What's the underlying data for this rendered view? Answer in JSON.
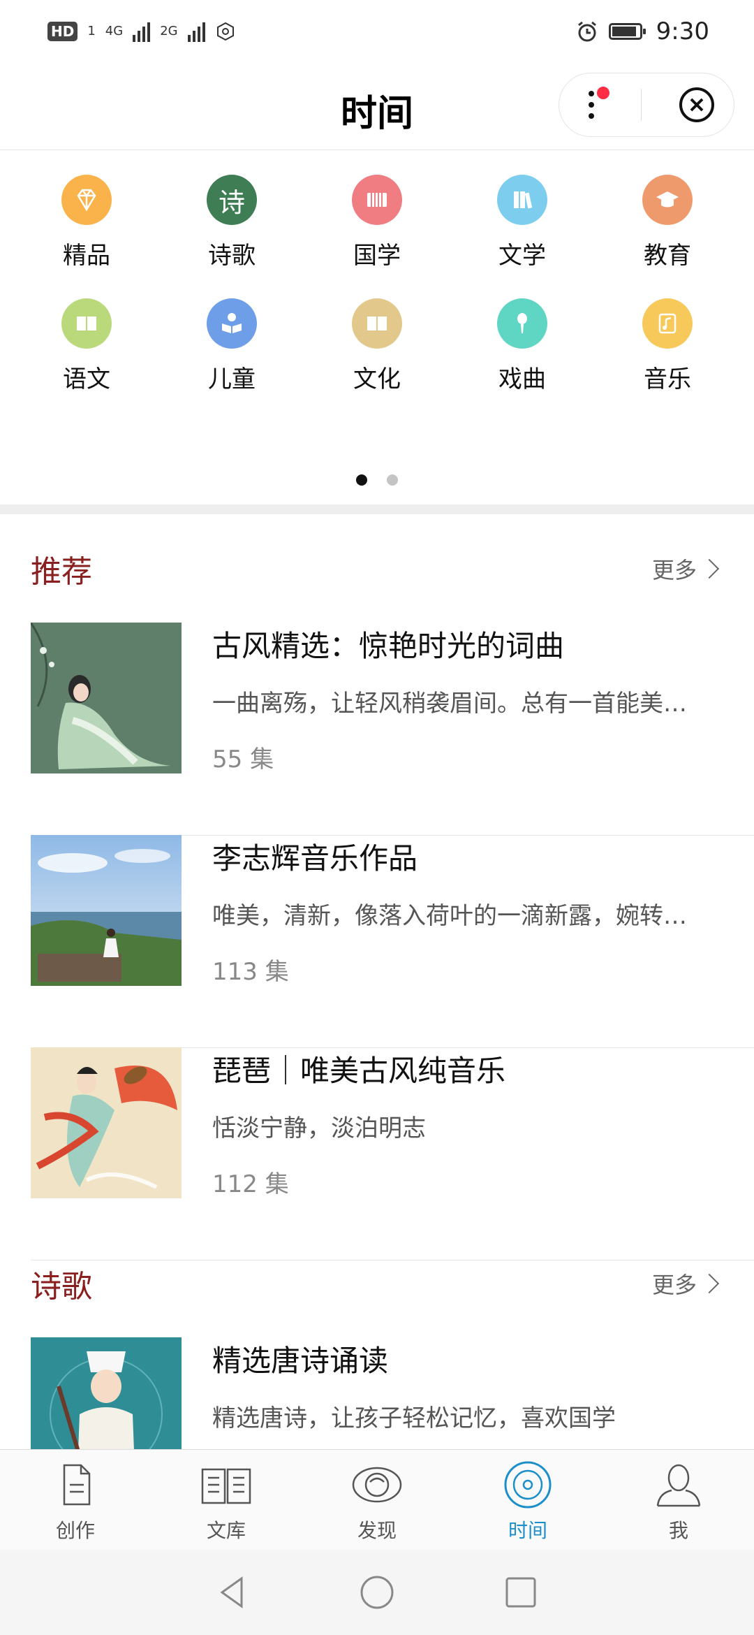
{
  "status_bar": {
    "time": "9:30",
    "hd": "HD",
    "sim": "1",
    "net1": "4G",
    "net2": "2G"
  },
  "header": {
    "title": "时间"
  },
  "categories": [
    {
      "label": "精品",
      "icon": "diamond-icon",
      "color": "#f9b34a"
    },
    {
      "label": "诗歌",
      "icon": "poem-icon",
      "color": "#3f7d55",
      "glyph": "诗"
    },
    {
      "label": "国学",
      "icon": "bamboo-scroll-icon",
      "color": "#f07d82"
    },
    {
      "label": "文学",
      "icon": "books-icon",
      "color": "#7ccdee"
    },
    {
      "label": "教育",
      "icon": "graduation-cap-icon",
      "color": "#ef9a6c"
    },
    {
      "label": "语文",
      "icon": "open-book-icon",
      "color": "#b9d97a"
    },
    {
      "label": "儿童",
      "icon": "child-reading-icon",
      "color": "#6f9ee8"
    },
    {
      "label": "文化",
      "icon": "book-icon",
      "color": "#e2c98b"
    },
    {
      "label": "戏曲",
      "icon": "microphone-icon",
      "color": "#5fd6c3"
    },
    {
      "label": "音乐",
      "icon": "music-note-icon",
      "color": "#f7c95a"
    }
  ],
  "pager": {
    "active": 0,
    "count": 2
  },
  "sections": [
    {
      "title": "推荐",
      "more_label": "更多",
      "items": [
        {
          "title": "古风精选：惊艳时光的词曲",
          "desc": "一曲离殇，让轻风稍袭眉间。总有一首能美…",
          "count": "55 集"
        },
        {
          "title": "李志辉音乐作品",
          "desc": "唯美，清新，像落入荷叶的一滴新露，婉转…",
          "count": "113 集"
        },
        {
          "title": "琵琶｜唯美古风纯音乐",
          "desc": "恬淡宁静，淡泊明志",
          "count": "112 集"
        }
      ]
    },
    {
      "title": "诗歌",
      "more_label": "更多",
      "items": [
        {
          "title": "精选唐诗诵读",
          "desc": "精选唐诗，让孩子轻松记忆，喜欢国学",
          "count": ""
        }
      ]
    }
  ],
  "tabs": [
    {
      "label": "创作",
      "icon": "document-icon",
      "active": false
    },
    {
      "label": "文库",
      "icon": "open-book-icon",
      "active": false
    },
    {
      "label": "发现",
      "icon": "eye-icon",
      "active": false
    },
    {
      "label": "时间",
      "icon": "disc-icon",
      "active": true
    },
    {
      "label": "我",
      "icon": "person-icon",
      "active": false
    }
  ],
  "colors": {
    "accent": "#1a8fc9",
    "section_title": "#8a1f1f"
  }
}
